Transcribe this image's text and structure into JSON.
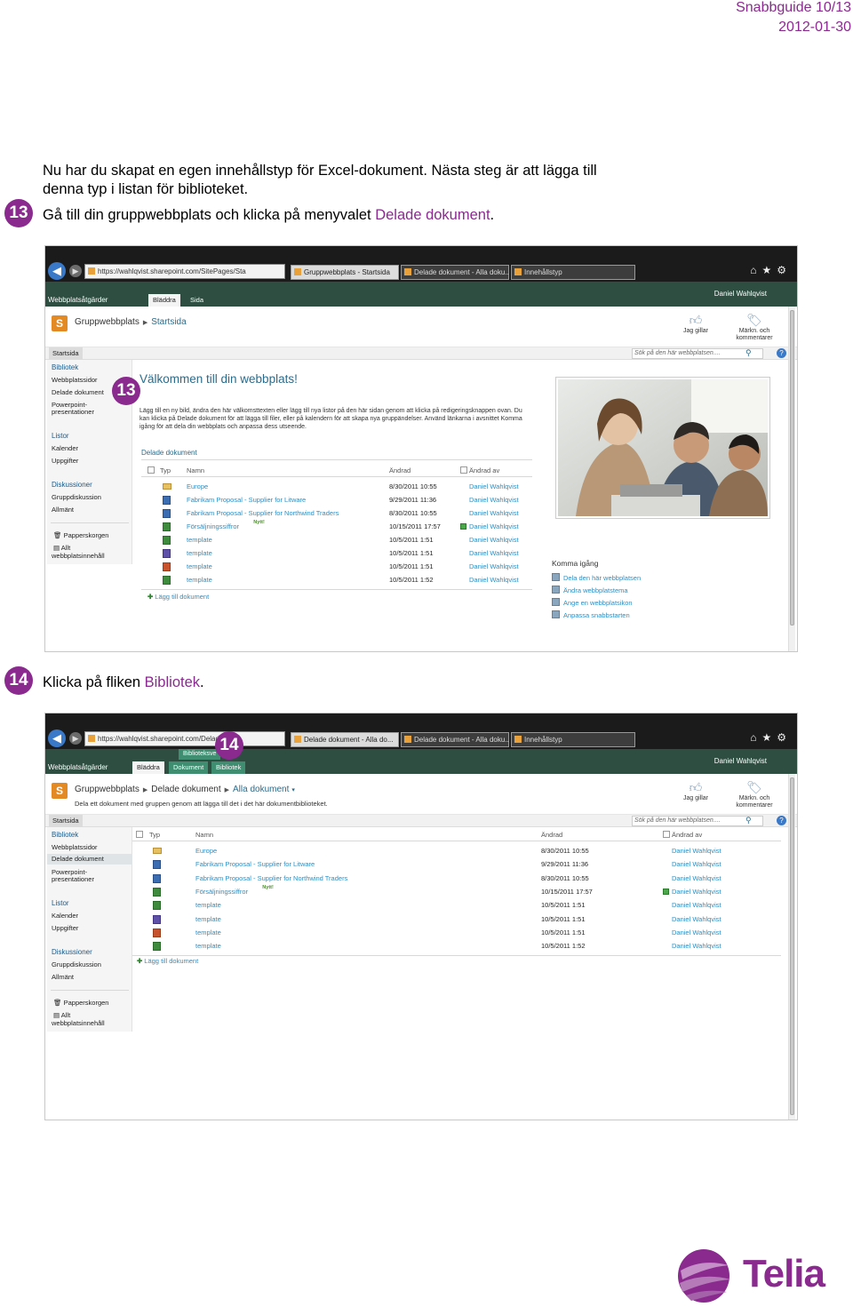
{
  "header": {
    "guide": "Snabbguide 10/13",
    "date": "2012-01-30"
  },
  "intro": "Nu har du skapat en egen innehållstyp för Excel-dokument. Nästa steg är att lägga till denna typ i listan för biblioteket.",
  "step13": {
    "num": "13",
    "text": "Gå till din gruppwebbplats och klicka på menyvalet ",
    "highlight": "Delade dokument",
    "tail": "."
  },
  "step14": {
    "num": "14",
    "text": "Klicka på fliken ",
    "highlight": "Bibliotek",
    "tail": "."
  },
  "shot1": {
    "url": "https://wahlqvist.sharepoint.com/SitePages/Sta",
    "tabs": [
      "Gruppwebbplats - Startsida",
      "Delade dokument - Alla doku...",
      "Innehållstyp"
    ],
    "ribbon": {
      "actions": "Webbplatsåtgärder",
      "tab_browse": "Bläddra",
      "tab_page": "Sida",
      "user": "Daniel Wahlqvist"
    },
    "breadcrumb": {
      "site": "Gruppwebbplats",
      "page": "Startsida"
    },
    "like": "Jag gillar",
    "tag_line1": "Märkn. och",
    "tag_line2": "kommentarer",
    "home_tab": "Startsida",
    "search_placeholder": "Sök på den här webbplatsen....",
    "quicklaunch": {
      "bibliotek": "Bibliotek",
      "webbplatssidor": "Webbplatssidor",
      "delade": "Delade dokument",
      "ppt1": "Powerpoint-",
      "ppt2": "presentationer",
      "listor": "Listor",
      "kalender": "Kalender",
      "uppgifter": "Uppgifter",
      "diskussioner": "Diskussioner",
      "gruppdiskussion": "Gruppdiskussion",
      "allmant": "Allmänt",
      "papperskorgen": "Papperskorgen",
      "allt1": "Allt",
      "allt2": "webbplatsinnehåll"
    },
    "badge": "13",
    "welcome_title": "Välkommen till din webbplats!",
    "welcome_text": "Lägg till en ny bild, ändra den här välkomsttexten eller lägg till nya listor på den här sidan genom att klicka på redigeringsknappen ovan. Du kan klicka på Delade dokument för att lägga till filer, eller på kalendern för att skapa nya gruppändelser. Använd länkarna i avsnittet Komma igång för att dela din webbplats och anpassa dess utseende.",
    "library_title": "Delade dokument",
    "columns": {
      "type": "Typ",
      "name": "Namn",
      "modified": "Ändrad",
      "modified_by": "Ändrad av"
    },
    "add_doc": "Lägg till dokument",
    "getting_started": {
      "title": "Komma igång",
      "items": [
        "Dela den här webbplatsen",
        "Ändra webbplatstema",
        "Ange en webbplatsikon",
        "Anpassa snabbstarten"
      ]
    }
  },
  "shot2": {
    "url": "https://wahlqvist.sharepoint.com/Delad",
    "tabs": [
      "Delade dokument - Alla do...",
      "Delade dokument - Alla doku...",
      "Innehållstyp"
    ],
    "ribbon": {
      "actions": "Webbplatsåtgärder",
      "tools": "Biblioteksve",
      "tab_browse": "Bläddra",
      "tab_docs": "Dokument",
      "tab_lib": "Bibliotek",
      "user": "Daniel Wahlqvist"
    },
    "breadcrumb": {
      "site": "Gruppwebbplats",
      "lib": "Delade dokument",
      "view": "Alla dokument"
    },
    "description": "Dela ett dokument med gruppen genom att lägga till det i det här dokumentbiblioteket.",
    "like": "Jag gillar",
    "tag_line1": "Märkn. och",
    "tag_line2": "kommentarer",
    "home_tab": "Startsida",
    "search_placeholder": "Sök på den här webbplatsen....",
    "badge": "14",
    "quicklaunch": {
      "bibliotek": "Bibliotek",
      "webbplatssidor": "Webbplatssidor",
      "delade": "Delade dokument",
      "ppt1": "Powerpoint-",
      "ppt2": "presentationer",
      "listor": "Listor",
      "kalender": "Kalender",
      "uppgifter": "Uppgifter",
      "diskussioner": "Diskussioner",
      "gruppdiskussion": "Gruppdiskussion",
      "allmant": "Allmänt",
      "papperskorgen": "Papperskorgen",
      "allt1": "Allt",
      "allt2": "webbplatsinnehåll"
    },
    "columns": {
      "type": "Typ",
      "name": "Namn",
      "modified": "Ändrad",
      "modified_by": "Ändrad av"
    },
    "add_doc": "Lägg till dokument"
  },
  "documents": [
    {
      "kind": "folder",
      "name": "Europe",
      "modified": "8/30/2011 10:55",
      "by": "Daniel Wahlqvist",
      "new": ""
    },
    {
      "kind": "word",
      "name": "Fabrikam Proposal - Supplier for Litware",
      "modified": "9/29/2011 11:36",
      "by": "Daniel Wahlqvist",
      "new": ""
    },
    {
      "kind": "word",
      "name": "Fabrikam Proposal - Supplier for Northwind Traders",
      "modified": "8/30/2011 10:55",
      "by": "Daniel Wahlqvist",
      "new": ""
    },
    {
      "kind": "excel",
      "name": "Försäljningssiffror",
      "modified": "10/15/2011 17:57",
      "by": "Daniel Wahlqvist",
      "new": "Nytt!"
    },
    {
      "kind": "excel",
      "name": "template",
      "modified": "10/5/2011 1:51",
      "by": "Daniel Wahlqvist",
      "new": ""
    },
    {
      "kind": "pub",
      "name": "template",
      "modified": "10/5/2011 1:51",
      "by": "Daniel Wahlqvist",
      "new": ""
    },
    {
      "kind": "ppt",
      "name": "template",
      "modified": "10/5/2011 1:51",
      "by": "Daniel Wahlqvist",
      "new": ""
    },
    {
      "kind": "excel",
      "name": "template",
      "modified": "10/5/2011 1:52",
      "by": "Daniel Wahlqvist",
      "new": ""
    }
  ],
  "brand": {
    "name": "Telia",
    "color": "#8a2a8f"
  }
}
